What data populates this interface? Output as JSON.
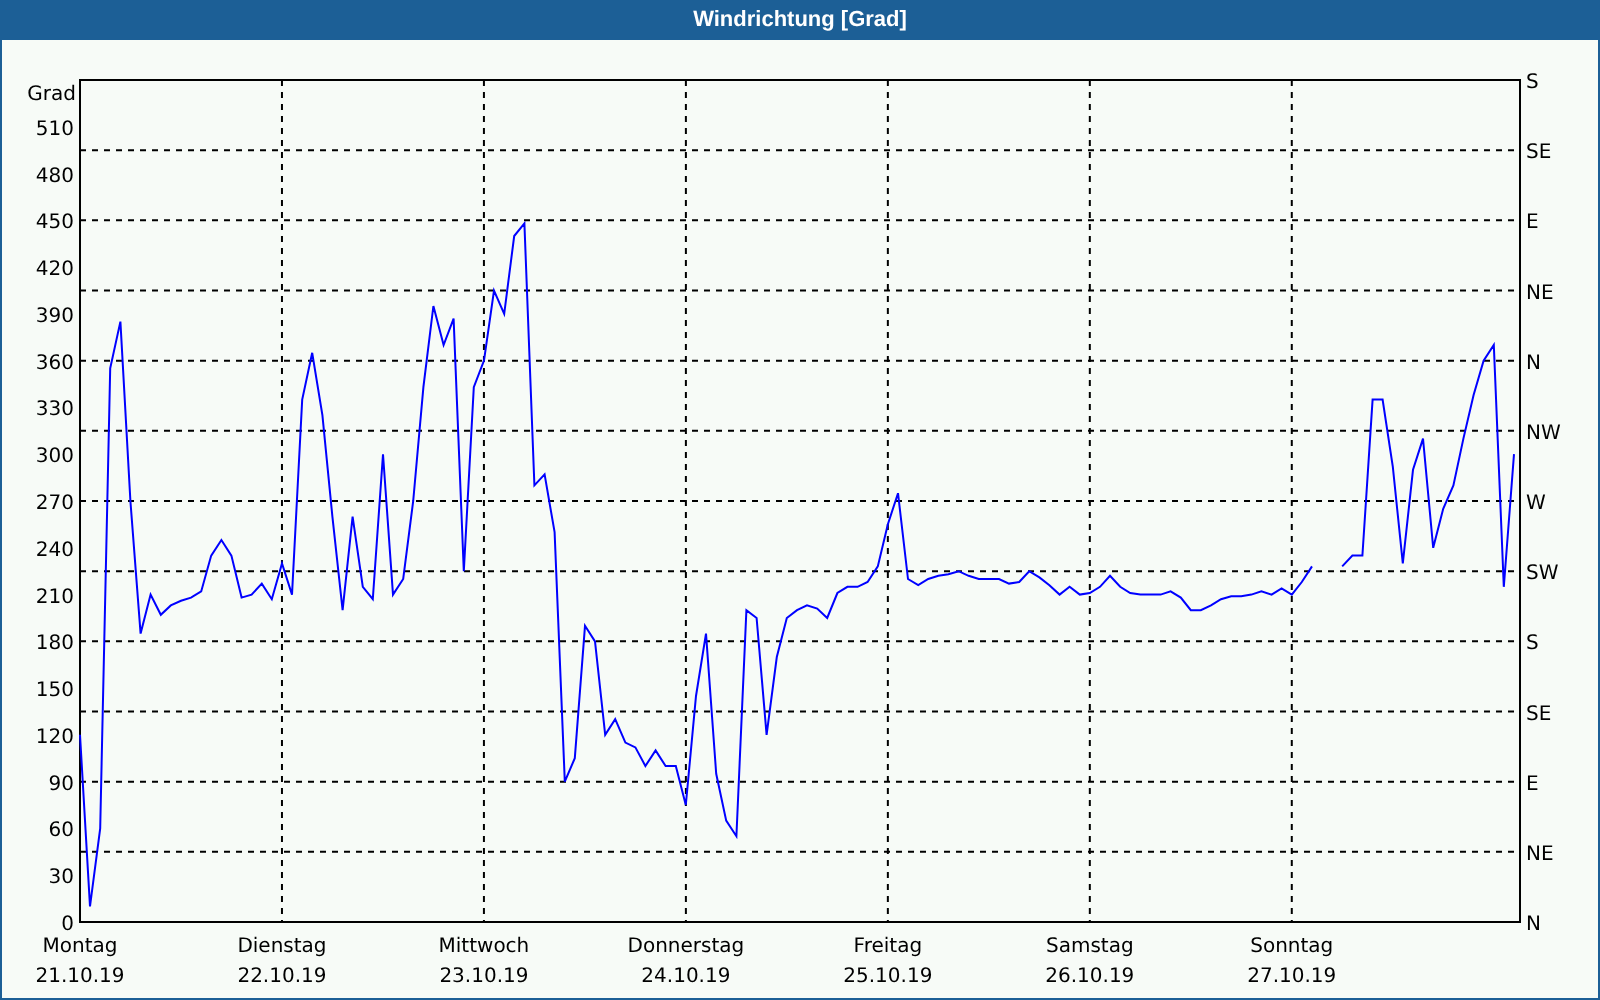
{
  "window": {
    "title": "Windrichtung [Grad]"
  },
  "chart": {
    "right_axis_labels": [
      "S",
      "SE",
      "E",
      "NE",
      "N",
      "NW",
      "W",
      "SW",
      "S",
      "SE",
      "E",
      "NE",
      "N"
    ],
    "chart_data": {
      "type": "line",
      "grid": true,
      "ylabel": "Grad",
      "ylim": [
        0,
        540
      ],
      "yticks": [
        0,
        30,
        60,
        90,
        120,
        150,
        180,
        210,
        240,
        270,
        300,
        330,
        360,
        390,
        420,
        450,
        480,
        510
      ],
      "categories": [
        "Montag\n21.10.19",
        null,
        null,
        null,
        null,
        null,
        null,
        null,
        null,
        null,
        null,
        null,
        null,
        null,
        null,
        null,
        null,
        null,
        null,
        null,
        "Dienstag\n22.10.19",
        null,
        null,
        null,
        null,
        null,
        null,
        null,
        null,
        null,
        null,
        null,
        null,
        null,
        null,
        null,
        null,
        null,
        null,
        null,
        "Mittwoch\n23.10.19",
        null,
        null,
        null,
        null,
        null,
        null,
        null,
        null,
        null,
        null,
        null,
        null,
        null,
        null,
        null,
        null,
        null,
        null,
        null,
        "Donnerstag\n24.10.19",
        null,
        null,
        null,
        null,
        null,
        null,
        null,
        null,
        null,
        null,
        null,
        null,
        null,
        null,
        null,
        null,
        null,
        null,
        null,
        "Freitag\n25.10.19",
        null,
        null,
        null,
        null,
        null,
        null,
        null,
        null,
        null,
        null,
        null,
        null,
        null,
        null,
        null,
        null,
        null,
        null,
        null,
        "Samstag\n26.10.19",
        null,
        null,
        null,
        null,
        null,
        null,
        null,
        null,
        null,
        null,
        null,
        null,
        null,
        null,
        null,
        null,
        null,
        null,
        null,
        "Sonntag\n27.10.19",
        null,
        null,
        null,
        null,
        null,
        null,
        null,
        null,
        null,
        null,
        null,
        null,
        null,
        null,
        null,
        null,
        null,
        null,
        null,
        null,
        null,
        null
      ],
      "series": [
        {
          "color": "#0000ff",
          "values": [
            120,
            10,
            60,
            355,
            385,
            270,
            185,
            210,
            197,
            203,
            206,
            208,
            212,
            235,
            245,
            235,
            208,
            210,
            217,
            207,
            230,
            210,
            335,
            365,
            325,
            260,
            200,
            260,
            215,
            207,
            300,
            210,
            220,
            270,
            343,
            395,
            370,
            387,
            225,
            343,
            360,
            405,
            390,
            440,
            448,
            280,
            287,
            250,
            90,
            105,
            190,
            180,
            120,
            130,
            115,
            112,
            100,
            110,
            100,
            100,
            75,
            145,
            185,
            95,
            65,
            55,
            200,
            195,
            120,
            170,
            195,
            200,
            203,
            201,
            195,
            211,
            215,
            215,
            218,
            228,
            255,
            275,
            220,
            216,
            220,
            222,
            223,
            225,
            222,
            220,
            220,
            220,
            217,
            218,
            225,
            221,
            216,
            210,
            215,
            210,
            211,
            215,
            222,
            215,
            211,
            210,
            210,
            210,
            212,
            208,
            200,
            200,
            203,
            207,
            209,
            209,
            210,
            212,
            210,
            214,
            210,
            218,
            228,
            null,
            null,
            228,
            235,
            235,
            335,
            335,
            292,
            230,
            290,
            310,
            240,
            265,
            280,
            310,
            338,
            360,
            370,
            215,
            300
          ]
        }
      ]
    }
  }
}
